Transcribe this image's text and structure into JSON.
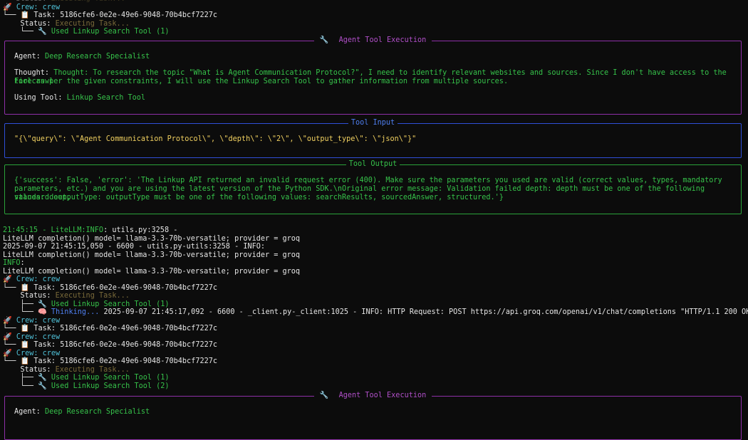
{
  "top_partial": "Status: Executing Task...",
  "tree1": {
    "crew_label": "Crew:",
    "crew_name": "crew",
    "task_label": "Task:",
    "task_id": "5186cfe6-0e2e-49e6-9048-70b4bcf7227c",
    "status_label": "Status:",
    "status_value": "Executing Task...",
    "tool1": "Used Linkup Search Tool (1)"
  },
  "box_agent1": {
    "title": "Agent Tool Execution",
    "agent_label": "Agent:",
    "agent_value": "Deep Research Specialist",
    "thought_label": "Thought:",
    "thought_line1": "Thought: To research the topic \"What is Agent Communication Protocol?\", I need to identify relevant websites and sources. Since I don't have access to the Firecrawl",
    "thought_line2": "tool as per the given constraints, I will use the Linkup Search Tool to gather information from multiple sources.",
    "using_label": "Using Tool:",
    "using_value": "Linkup Search Tool"
  },
  "box_input": {
    "title": "Tool Input",
    "value": "\"{\\\"query\\\": \\\"Agent Communication Protocol\\\", \\\"depth\\\": \\\"2\\\", \\\"output_type\\\": \\\"json\\\"}\""
  },
  "box_output": {
    "title": "Tool Output",
    "line1": "{'success': False, 'error': 'The Linkup API returned an invalid request error (400). Make sure the parameters you used are valid (correct values, types, mandatory",
    "line2": "parameters, etc.) and you are using the latest version of the Python SDK.\\nOriginal error message: Validation failed depth: depth must be one of the following values: deep,",
    "line3": "standard outputType: outputType must be one of the following values: searchResults, sourcedAnswer, structured.'}"
  },
  "log": {
    "l1_time": "21:45:15 - LiteLLM:INFO",
    "l1_rest": ": utils.py:3258 -",
    "l2": "LiteLLM completion() model= llama-3.3-70b-versatile; provider = groq",
    "l3": "2025-09-07 21:45:15,050 - 6600 - utils.py-utils:3258 - INFO:",
    "l4": "LiteLLM completion() model= llama-3.3-70b-versatile; provider = groq",
    "l5": "INFO",
    "l5_rest": ":",
    "l6": "LiteLLM completion() model= llama-3.3-70b-versatile; provider = groq"
  },
  "tree2": {
    "status_value": "Executing Task...",
    "tool1": "Used Linkup Search Tool (1)",
    "thinking": "Thinking...",
    "thinking_rest": "2025-09-07 21:45:17,092 - 6600 - _client.py-_client:1025 - INFO: HTTP Request: POST https://api.groq.com/openai/v1/chat/completions \"HTTP/1.1 200 OK\""
  },
  "tree5": {
    "tool1": "Used Linkup Search Tool (1)",
    "tool2": "Used Linkup Search Tool (2)"
  },
  "box_agent2": {
    "title": "Agent Tool Execution",
    "agent_label": "Agent:",
    "agent_value": "Deep Research Specialist"
  }
}
